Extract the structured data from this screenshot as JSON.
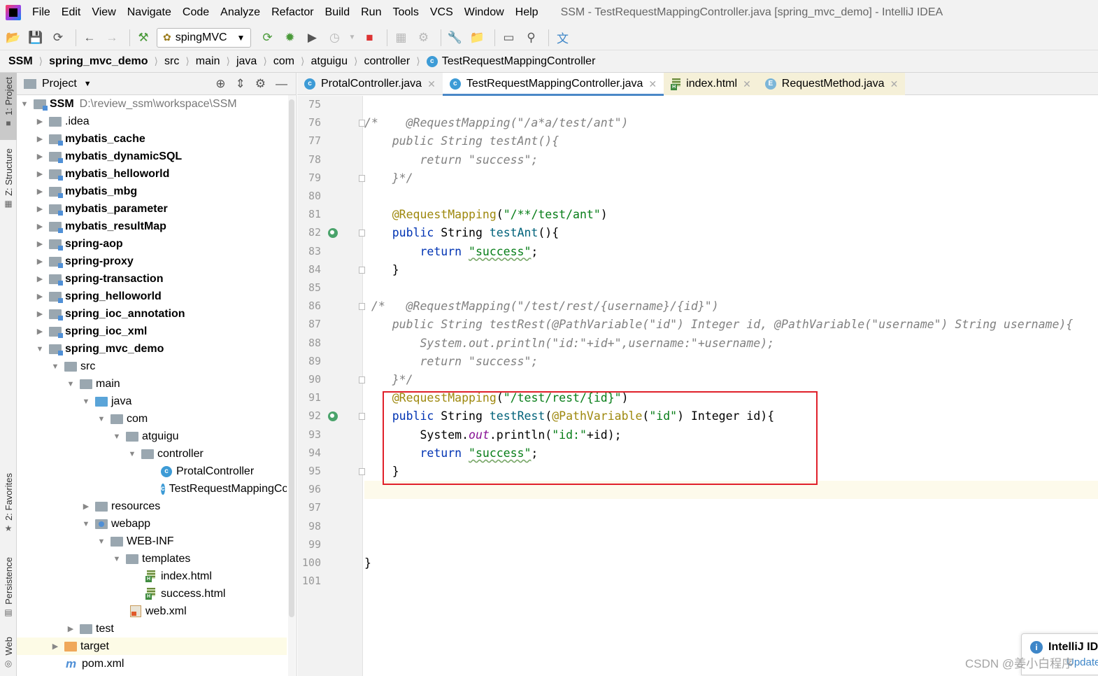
{
  "window_title": "SSM - TestRequestMappingController.java [spring_mvc_demo] - IntelliJ IDEA",
  "menu": [
    "File",
    "Edit",
    "View",
    "Navigate",
    "Code",
    "Analyze",
    "Refactor",
    "Build",
    "Run",
    "Tools",
    "VCS",
    "Window",
    "Help"
  ],
  "run_config": "spingMVC",
  "breadcrumb": [
    "SSM",
    "spring_mvc_demo",
    "src",
    "main",
    "java",
    "com",
    "atguigu",
    "controller",
    "TestRequestMappingController"
  ],
  "side_tabs": [
    "1: Project",
    "Z: Structure",
    "2: Favorites",
    "Persistence",
    "Web"
  ],
  "project_panel": {
    "title": "Project",
    "tree": [
      {
        "label": "SSM",
        "path": "D:\\review_ssm\\workspace\\SSM"
      },
      {
        "label": ".idea"
      },
      {
        "label": "mybatis_cache"
      },
      {
        "label": "mybatis_dynamicSQL"
      },
      {
        "label": "mybatis_helloworld"
      },
      {
        "label": "mybatis_mbg"
      },
      {
        "label": "mybatis_parameter"
      },
      {
        "label": "mybatis_resultMap"
      },
      {
        "label": "spring-aop"
      },
      {
        "label": "spring-proxy"
      },
      {
        "label": "spring-transaction"
      },
      {
        "label": "spring_helloworld"
      },
      {
        "label": "spring_ioc_annotation"
      },
      {
        "label": "spring_ioc_xml"
      },
      {
        "label": "spring_mvc_demo"
      },
      {
        "label": "src"
      },
      {
        "label": "main"
      },
      {
        "label": "java"
      },
      {
        "label": "com"
      },
      {
        "label": "atguigu"
      },
      {
        "label": "controller"
      },
      {
        "label": "ProtalController"
      },
      {
        "label": "TestRequestMappingController"
      },
      {
        "label": "resources"
      },
      {
        "label": "webapp"
      },
      {
        "label": "WEB-INF"
      },
      {
        "label": "templates"
      },
      {
        "label": "index.html"
      },
      {
        "label": "success.html"
      },
      {
        "label": "web.xml"
      },
      {
        "label": "test"
      },
      {
        "label": "target"
      },
      {
        "label": "pom.xml"
      }
    ]
  },
  "editor_tabs": [
    {
      "label": "ProtalController.java",
      "icon": "class-icon"
    },
    {
      "label": "TestRequestMappingController.java",
      "icon": "class-icon",
      "active": true
    },
    {
      "label": "index.html",
      "icon": "html-file-icon"
    },
    {
      "label": "RequestMethod.java",
      "icon": "enum-icon"
    }
  ],
  "code": {
    "line_numbers": [
      "75",
      "76",
      "77",
      "78",
      "79",
      "80",
      "81",
      "82",
      "83",
      "84",
      "85",
      "86",
      "87",
      "88",
      "89",
      "90",
      "91",
      "92",
      "93",
      "94",
      "95",
      "96",
      "97",
      "98",
      "99",
      "100",
      "101"
    ],
    "lines": [
      [],
      [
        {
          "c": "cm",
          "t": "/*    @RequestMapping(\"/a*a/test/ant\")"
        }
      ],
      [
        {
          "c": "cm",
          "t": "    public String testAnt(){"
        }
      ],
      [
        {
          "c": "cm",
          "t": "        return \"success\";"
        }
      ],
      [
        {
          "c": "cm",
          "t": "    }*/"
        }
      ],
      [],
      [
        {
          "c": "",
          "t": "    "
        },
        {
          "c": "an",
          "t": "@RequestMapping"
        },
        {
          "c": "",
          "t": "("
        },
        {
          "c": "st",
          "t": "\"/**/test/ant\""
        },
        {
          "c": "",
          "t": ")"
        }
      ],
      [
        {
          "c": "kw",
          "t": "    public "
        },
        {
          "c": "",
          "t": "String "
        },
        {
          "c": "fn",
          "t": "testAnt"
        },
        {
          "c": "",
          "t": "(){"
        }
      ],
      [
        {
          "c": "kw",
          "t": "        return "
        },
        {
          "c": "st wavy",
          "t": "\"success\""
        },
        {
          "c": "",
          "t": ";"
        }
      ],
      [
        {
          "c": "",
          "t": "    }"
        }
      ],
      [],
      [
        {
          "c": "cm",
          "t": " /*   @RequestMapping(\"/test/rest/{username}/{id}\")"
        }
      ],
      [
        {
          "c": "cm",
          "t": "    public String testRest(@PathVariable(\"id\") Integer id, @PathVariable(\"username\") String username){"
        }
      ],
      [
        {
          "c": "cm",
          "t": "        System.out.println(\"id:\"+id+\",username:\"+username);"
        }
      ],
      [
        {
          "c": "cm",
          "t": "        return \"success\";"
        }
      ],
      [
        {
          "c": "cm",
          "t": "    }*/"
        }
      ],
      [
        {
          "c": "",
          "t": "    "
        },
        {
          "c": "an",
          "t": "@RequestMapping"
        },
        {
          "c": "",
          "t": "("
        },
        {
          "c": "st",
          "t": "\"/test/rest/{id}\""
        },
        {
          "c": "",
          "t": ")"
        }
      ],
      [
        {
          "c": "kw",
          "t": "    public "
        },
        {
          "c": "",
          "t": "String "
        },
        {
          "c": "fn",
          "t": "testRest"
        },
        {
          "c": "",
          "t": "("
        },
        {
          "c": "an",
          "t": "@PathVariable"
        },
        {
          "c": "",
          "t": "("
        },
        {
          "c": "st",
          "t": "\"id\""
        },
        {
          "c": "",
          "t": ") Integer id){"
        }
      ],
      [
        {
          "c": "",
          "t": "        System."
        },
        {
          "c": "fi",
          "t": "out"
        },
        {
          "c": "",
          "t": ".println("
        },
        {
          "c": "st",
          "t": "\"id:\""
        },
        {
          "c": "",
          "t": "+id);"
        }
      ],
      [
        {
          "c": "kw",
          "t": "        return "
        },
        {
          "c": "st wavy",
          "t": "\"success\""
        },
        {
          "c": "",
          "t": ";"
        }
      ],
      [
        {
          "c": "",
          "t": "    }"
        }
      ],
      [],
      [],
      [],
      [],
      [
        {
          "c": "",
          "t": "}"
        }
      ],
      []
    ],
    "run_marker_lines": [
      "82",
      "92"
    ]
  },
  "notification": {
    "title": "IntelliJ ID",
    "link": "Update..."
  },
  "watermark": "CSDN @姜小白程序"
}
